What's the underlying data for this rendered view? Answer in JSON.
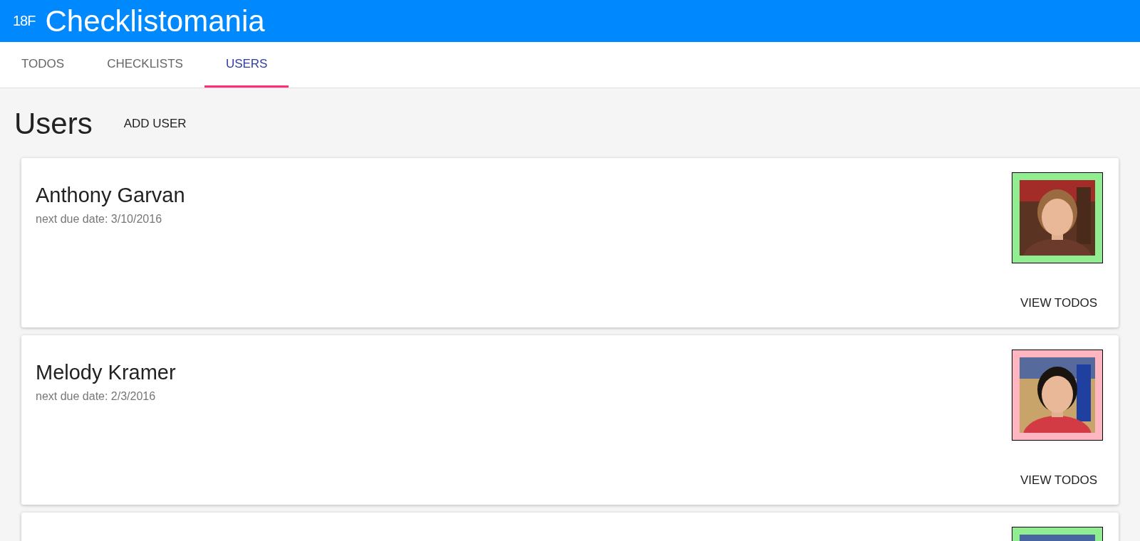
{
  "app_bar": {
    "logo": "18F",
    "title": "Checklistomania"
  },
  "tabs": [
    {
      "label": "TODOS",
      "selected": false
    },
    {
      "label": "CHECKLISTS",
      "selected": false
    },
    {
      "label": "USERS",
      "selected": true
    }
  ],
  "page": {
    "heading": "Users",
    "add_button": "ADD USER"
  },
  "users": [
    {
      "name": "Anthony Garvan",
      "next_due": "next due date: 3/10/2016",
      "color": "#90ee90",
      "button": "VIEW TODOS"
    },
    {
      "name": "Melody Kramer",
      "next_due": "next due date: 2/3/2016",
      "color": "#ffb6c1",
      "button": "VIEW TODOS"
    },
    {
      "color": "#90ee90"
    }
  ]
}
